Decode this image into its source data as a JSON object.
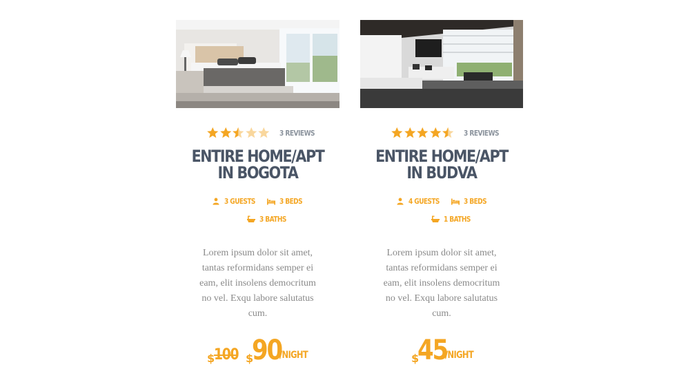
{
  "colors": {
    "accent": "#f4a623",
    "title": "#4a5566",
    "muted": "#8a929c",
    "body_text": "#8a8a8a"
  },
  "listings": [
    {
      "image": "bedroom-photo",
      "rating": 2.5,
      "rating_max": 5,
      "reviews": "3 REVIEWS",
      "title_line1": "ENTIRE HOME/APT",
      "title_line2": "IN BOGOTA",
      "guests": "3 GUESTS",
      "beds": "3 BEDS",
      "baths": "3 BATHS",
      "description": "Lorem ipsum dolor sit amet, tantas reformidans semper ei eam, elit insolens democritum no vel. Exqu labore salutatus cum.",
      "currency": "$",
      "old_price": "100",
      "price": "90",
      "per": "/NIGHT"
    },
    {
      "image": "living-room-photo",
      "rating": 4.5,
      "rating_max": 5,
      "reviews": "3 REVIEWS",
      "title_line1": "ENTIRE HOME/APT",
      "title_line2": "IN BUDVA",
      "guests": "4 GUESTS",
      "beds": "3 BEDS",
      "baths": "1 BATHS",
      "description": "Lorem ipsum dolor sit amet, tantas reformidans semper ei eam, elit insolens democritum no vel. Exqu labore salutatus cum.",
      "currency": "$",
      "price": "45",
      "per": "/NIGHT"
    }
  ]
}
